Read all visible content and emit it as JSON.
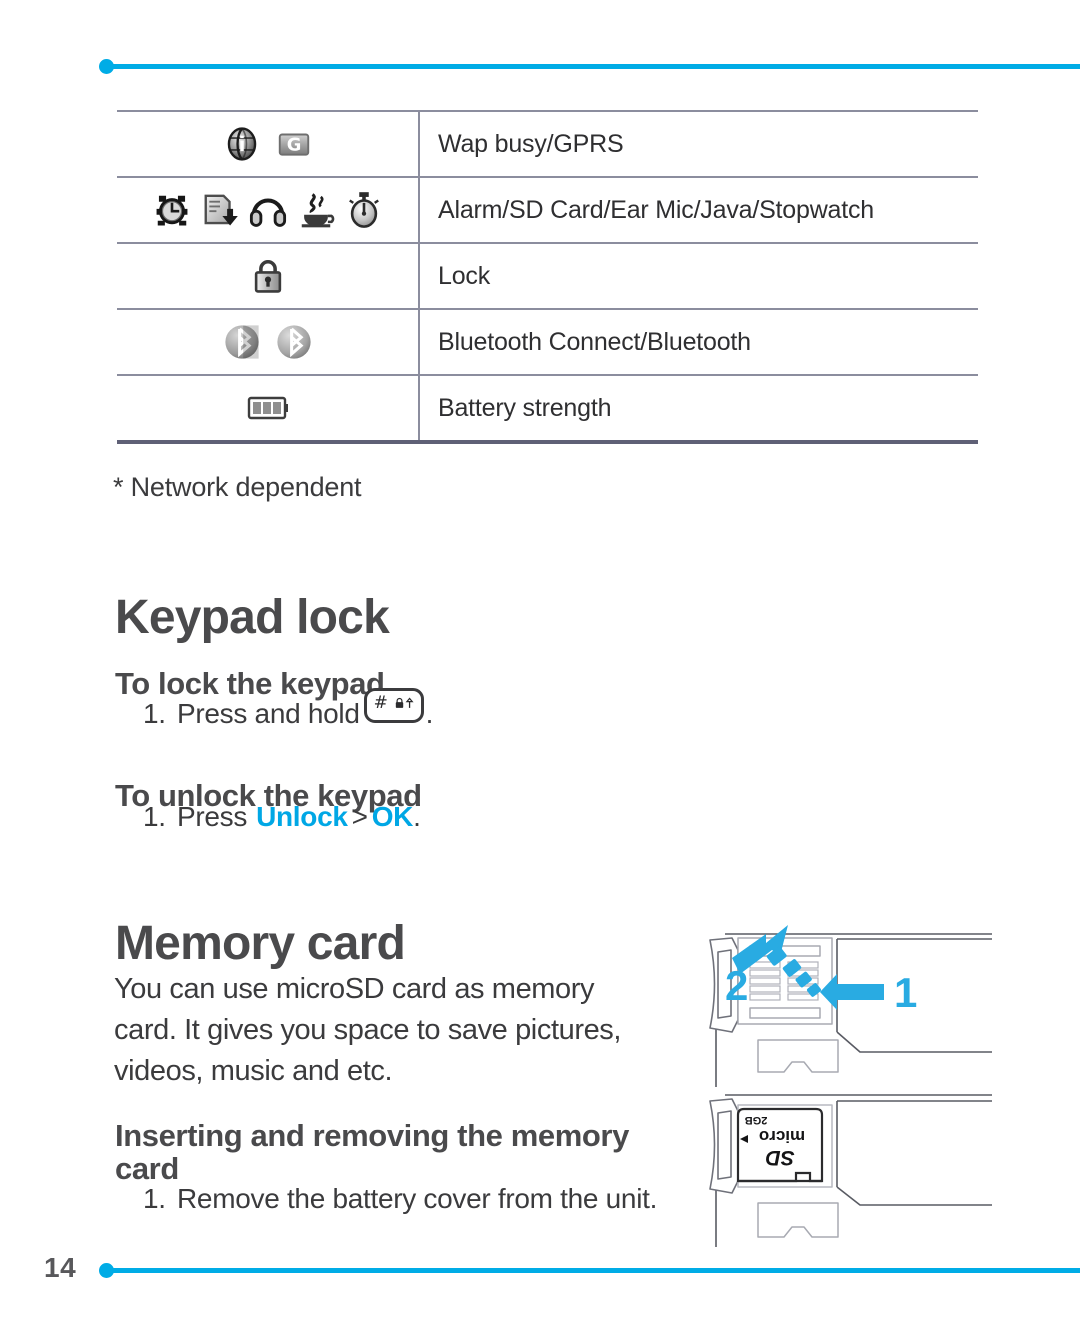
{
  "page": {
    "number": "14",
    "accent_color": "#00ace6",
    "text_color": "#3b3b3d",
    "heading_color": "#4a4a4c"
  },
  "icon_table": {
    "rows": [
      {
        "icons": [
          "wap-busy-globe-icon",
          "gprs-g-icon"
        ],
        "description": "Wap busy/GPRS"
      },
      {
        "icons": [
          "alarm-clock-icon",
          "sd-card-icon",
          "ear-mic-headphones-icon",
          "java-coffee-icon",
          "stopwatch-icon"
        ],
        "description": "Alarm/SD Card/Ear Mic/Java/Stopwatch"
      },
      {
        "icons": [
          "padlock-icon"
        ],
        "description": "Lock"
      },
      {
        "icons": [
          "bluetooth-connect-icon",
          "bluetooth-icon"
        ],
        "description": "Bluetooth Connect/Bluetooth"
      },
      {
        "icons": [
          "battery-strength-icon"
        ],
        "description": "Battery strength"
      }
    ]
  },
  "footnote": "* Network dependent",
  "sections": {
    "keypad_lock": {
      "title": "Keypad lock",
      "lock": {
        "subtitle": "To lock the keypad",
        "step_number": "1.",
        "step_prefix": "Press and hold",
        "step_suffix": ".",
        "key_icon": "hash-lock-key-icon"
      },
      "unlock": {
        "subtitle": "To unlock the keypad",
        "step_number": "1.",
        "step_prefix": "Press",
        "link_1": "Unlock",
        "separator": ">",
        "link_2": "OK",
        "step_suffix": "."
      }
    },
    "memory_card": {
      "title": "Memory card",
      "paragraph": "You can use microSD card as memory card. It gives you space to save pictures, videos, music and etc.",
      "insert_remove": {
        "subtitle": "Inserting and removing the memory card",
        "step_number": "1.",
        "step_text": "Remove the battery cover from the unit."
      }
    }
  },
  "illustrations": {
    "top": {
      "name": "battery-cover-removal-diagram",
      "labels": [
        "1",
        "2"
      ],
      "arrow_color": "#29ABE2"
    },
    "bottom": {
      "name": "microsd-card-insert-diagram",
      "card_label": "micro",
      "card_brand": "SD",
      "card_capacity": "2GB"
    }
  }
}
